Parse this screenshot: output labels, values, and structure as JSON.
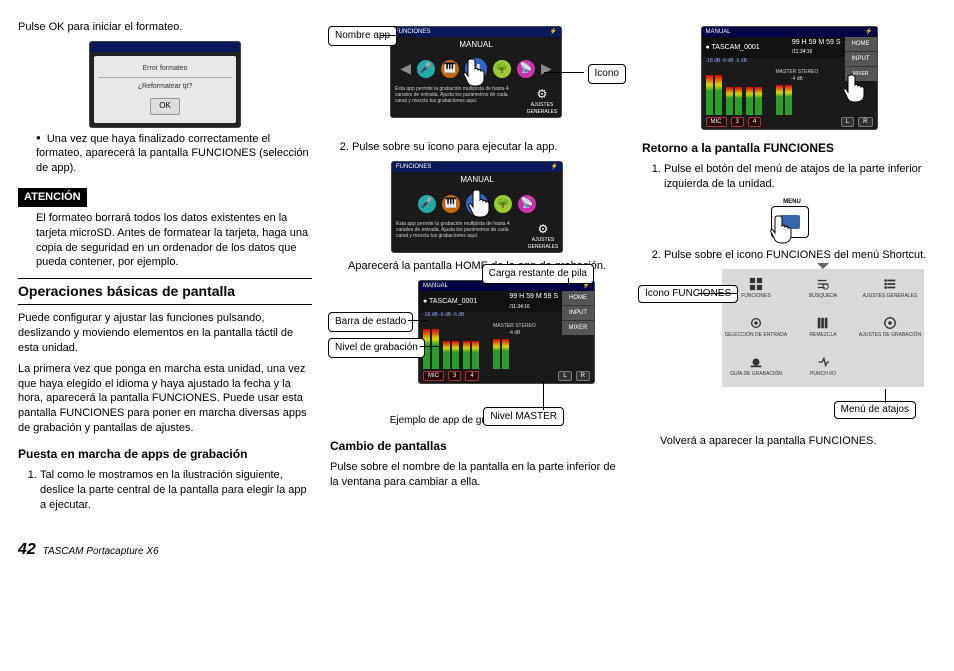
{
  "col1": {
    "p1": "Pulse OK para iniciar el formateo.",
    "dialog": {
      "title": "Error formateo",
      "msg": "¿Reformatear tjt?",
      "ok": "OK"
    },
    "bullet1": "Una vez que haya finalizado correctamente el formateo, aparecerá la pantalla FUNCIONES (selección de app).",
    "attention": "ATENCIÓN",
    "att_body": "El formateo borrará todos los datos existentes en la tarjeta microSD. Antes de formatear la tarjeta, haga una copia de seguridad en un ordenador de los datos que pueda contener, por ejemplo.",
    "h2": "Operaciones básicas de pantalla",
    "p2": "Puede configurar y ajustar las funciones pulsando, deslizando y moviendo elementos en la pantalla táctil de esta unidad.",
    "p3": "La primera vez que ponga en marcha esta unidad, una vez que haya elegido el idioma y haya ajustado la fecha y la hora, aparecerá la pantalla FUNCIONES. Puede usar esta pantalla FUNCIONES para poner en marcha diversas apps de grabación y pantallas de ajustes.",
    "h3": "Puesta en marcha de apps de grabación",
    "ol1": "Tal como le mostramos en la ilustración siguiente, deslice la parte central de la pantalla para elegir la app a ejecutar."
  },
  "col2": {
    "callouts": {
      "nombre": "Nombre app",
      "icono": "Icono",
      "carga": "Carga restante de pila",
      "barra": "Barra de estado",
      "nivel_g": "Nivel de grabación",
      "nivel_m": "Nivel MASTER"
    },
    "app": {
      "funciones": "FUNCIONES",
      "manual": "MANUAL",
      "ajustes": "AJUSTES GENERALES",
      "desc": "Esta app permite la grabación multipista de hasta 4 canales de entrada. Ajusta los parámetros de cada canal y mezcla tus grabaciones aquí."
    },
    "ol2": "Pulse sobre su icono para ejecutar la app.",
    "p4": "Aparecerá la pantalla HOME de la app de grabación.",
    "home": {
      "file": "TASCAM_0001",
      "timer": "99 H 59 M 59 S",
      "total": "/11:34:16",
      "master": "MASTER STEREO",
      "db": "-4 dB",
      "home_btn": "HOME",
      "input_btn": "INPUT",
      "mixer_btn": "MIXER",
      "ch_mic": "MIC",
      "ch_3": "3",
      "ch_4": "4",
      "ch_l": "L",
      "ch_r": "R",
      "levels": "-18 dB  -6 dB  -6 dB"
    },
    "caption": "Ejemplo de app de grabación MANUAL",
    "h3b": "Cambio de pantallas",
    "p5": "Pulse sobre el nombre de la pantalla en la parte inferior de la ventana para cambiar a ella."
  },
  "col3": {
    "h3c": "Retorno a la pantalla FUNCIONES",
    "ol3": "Pulse el botón del menú de atajos de la parte inferior izquierda de la unidad.",
    "menu_label": "MENU",
    "ol4": "Pulse sobre el icono FUNCIONES del menú Shortcut.",
    "callout_icono": "Icono FUNCIONES",
    "callout_menu": "Menú de atajos",
    "shortcuts": {
      "funciones": "FUNCIONES",
      "busqueda": "BÚSQUEDA",
      "ajustes_gen": "AJUSTES GENERALES",
      "sel_entrada": "SELECCIÓN DE ENTRADA",
      "remezcla": "REMEZCLA",
      "ajustes_grab": "AJUSTES DE GRABACIÓN",
      "guia": "GUÍA DE GRABACIÓN",
      "punch": "PUNCH I/O"
    },
    "p6": "Volverá a aparecer la pantalla FUNCIONES."
  },
  "footer": {
    "page": "42",
    "product": "TASCAM Portacapture X6"
  }
}
